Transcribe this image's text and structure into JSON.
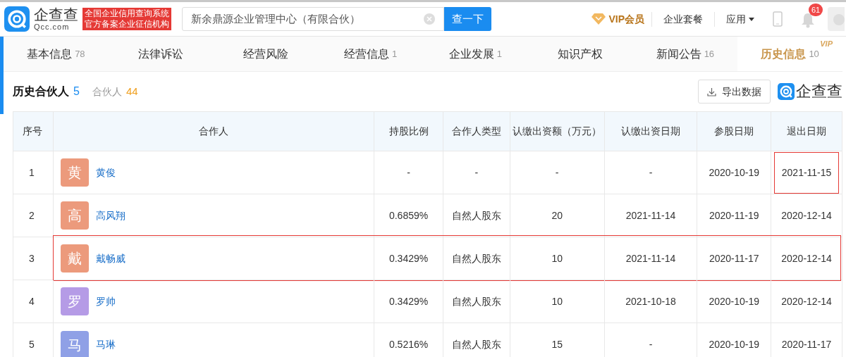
{
  "header": {
    "logo": {
      "name": "企查查",
      "domain": "Qcc.com"
    },
    "badge_lines": [
      "全国企业信用查询系统",
      "官方备案企业征信机构"
    ],
    "search": {
      "value": "新余鼎源企业管理中心（有限合伙）",
      "button": "查一下"
    },
    "nav": [
      {
        "kind": "vip",
        "label": "VIP会员"
      },
      {
        "kind": "text",
        "label": "企业套餐"
      },
      {
        "kind": "dropdown",
        "label": "应用"
      }
    ],
    "notifications": "61"
  },
  "tabs": [
    {
      "label": "基本信息",
      "count": "78",
      "selected": false
    },
    {
      "label": "法律诉讼",
      "selected": false
    },
    {
      "label": "经营风险",
      "selected": false
    },
    {
      "label": "经营信息",
      "count": "1",
      "selected": false
    },
    {
      "label": "企业发展",
      "count": "1",
      "selected": false
    },
    {
      "label": "知识产权",
      "selected": false
    },
    {
      "label": "新闻公告",
      "count": "16",
      "selected": false
    },
    {
      "label": "历史信息",
      "count": "10",
      "vip": "VIP",
      "selected": true
    }
  ],
  "section": {
    "subtabs": [
      {
        "label": "历史合伙人",
        "count": "5",
        "selected": true
      },
      {
        "label": "合伙人",
        "count": "44",
        "selected": false
      }
    ],
    "export_button": "导出数据",
    "watermark_logo": "企查查"
  },
  "table": {
    "columns": [
      "序号",
      "合作人",
      "持股比例",
      "合作人类型",
      "认缴出资额（万元）",
      "认缴出资日期",
      "参股日期",
      "退出日期"
    ],
    "rows": [
      {
        "index": "1",
        "avatar": "黄",
        "color": "#ec9a7c",
        "name": "黄俊",
        "share": "-",
        "type": "-",
        "amount": "-",
        "subscribe_date": "-",
        "join_date": "2020-10-19",
        "exit_date": "2021-11-15",
        "highlighted": false,
        "exit_highlighted": true
      },
      {
        "index": "2",
        "avatar": "高",
        "color": "#ec9a7c",
        "name": "高风翔",
        "share": "0.6859%",
        "type": "自然人股东",
        "amount": "20",
        "subscribe_date": "2021-11-14",
        "join_date": "2020-11-19",
        "exit_date": "2020-12-14",
        "highlighted": false,
        "exit_highlighted": false
      },
      {
        "index": "3",
        "avatar": "戴",
        "color": "#ec9a7c",
        "name": "戴畅威",
        "share": "0.3429%",
        "type": "自然人股东",
        "amount": "10",
        "subscribe_date": "2021-11-14",
        "join_date": "2020-11-17",
        "exit_date": "2020-12-14",
        "highlighted": true,
        "exit_highlighted": false
      },
      {
        "index": "4",
        "avatar": "罗",
        "color": "#b59be6",
        "name": "罗帅",
        "share": "0.3429%",
        "type": "自然人股东",
        "amount": "10",
        "subscribe_date": "2021-10-18",
        "join_date": "2020-10-19",
        "exit_date": "2020-12-14",
        "highlighted": false,
        "exit_highlighted": false
      },
      {
        "index": "5",
        "avatar": "马",
        "color": "#8fa0e6",
        "name": "马琳",
        "share": "0.5216%",
        "type": "自然人股东",
        "amount": "15",
        "subscribe_date": "-",
        "join_date": "2020-10-19",
        "exit_date": "2020-11-17",
        "highlighted": false,
        "exit_highlighted": false
      }
    ]
  }
}
